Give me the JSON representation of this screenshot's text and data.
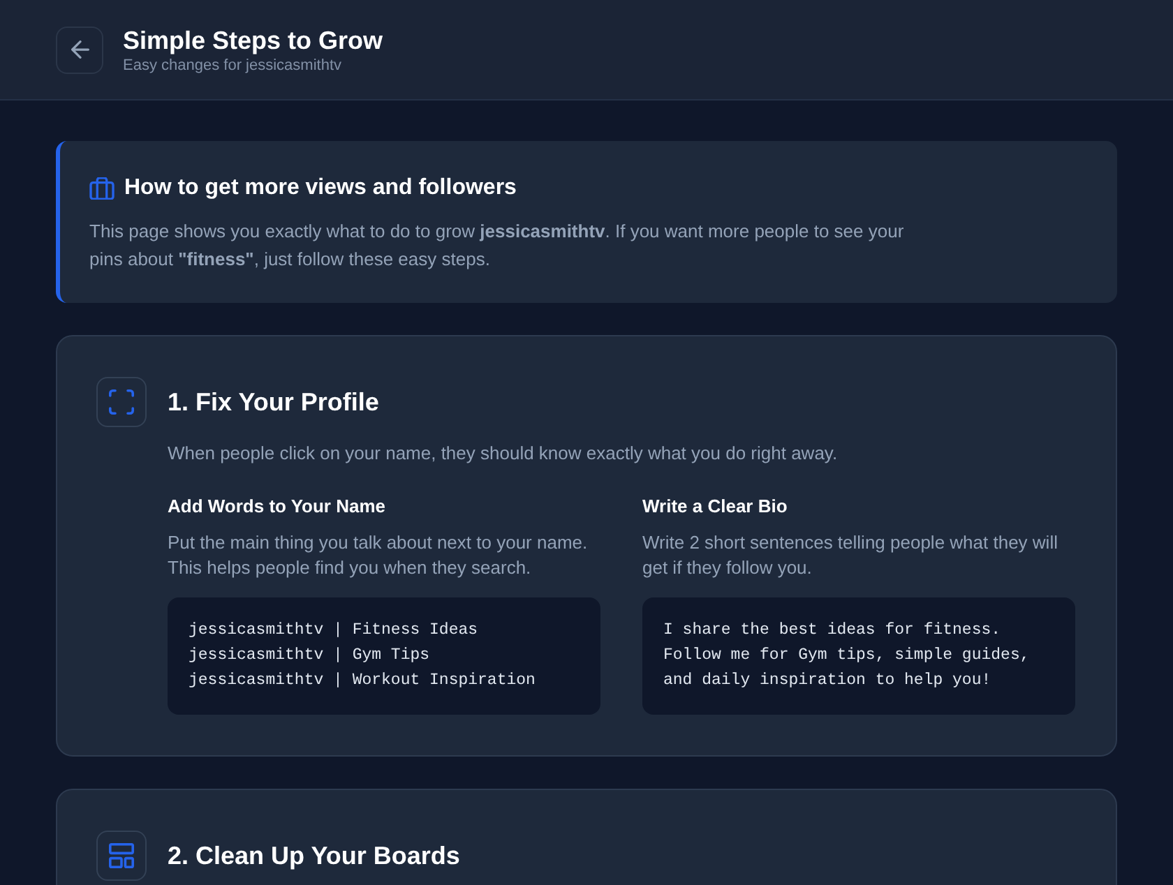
{
  "header": {
    "title": "Simple Steps to Grow",
    "subtitle": "Easy changes for jessicasmithtv"
  },
  "intro": {
    "title": "How to get more views and followers",
    "text": "This page shows you exactly what to do to grow **jessicasmithtv**. If you want more people to see your pins about **\"fitness\"**, just follow these easy steps."
  },
  "steps": [
    {
      "kind": "profile",
      "title": "1. Fix Your Profile",
      "description": "When people click on your name, they should know exactly what you do right away.",
      "tips": [
        {
          "title": "Add Words to Your Name",
          "text": "Put the main thing you talk about next to your name. This helps people find you when they search.",
          "example_lines": [
            "jessicasmithtv | Fitness Ideas",
            "jessicasmithtv | Gym Tips",
            "jessicasmithtv | Workout Inspiration"
          ]
        },
        {
          "title": "Write a Clear Bio",
          "text": "Write 2 short sentences telling people what they will get if they follow you.",
          "example_lines": [
            "I share the best ideas for fitness.",
            "Follow me for Gym tips, simple guides,",
            "and daily inspiration to help you!"
          ]
        }
      ]
    },
    {
      "kind": "boards",
      "title": "2. Clean Up Your Boards"
    }
  ]
}
